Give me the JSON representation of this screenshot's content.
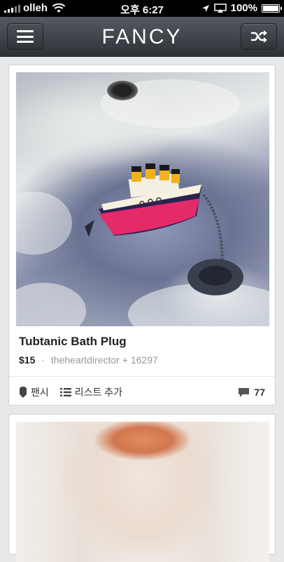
{
  "status_bar": {
    "carrier": "olleh",
    "time": "오후 6:27",
    "battery": "100%"
  },
  "nav": {
    "logo": "FANCY",
    "menu_icon": "hamburger-icon",
    "shuffle_icon": "shuffle-icon"
  },
  "items": [
    {
      "title": "Tubtanic Bath Plug",
      "price": "$15",
      "seller": "theheartdirector",
      "fancy_count": "+ 16297",
      "fancy_label": "팬시",
      "list_label": "리스트 추가",
      "comment_count": "77"
    }
  ],
  "colors": {
    "navbar": "#3a4045",
    "background": "#e6e8ea"
  }
}
